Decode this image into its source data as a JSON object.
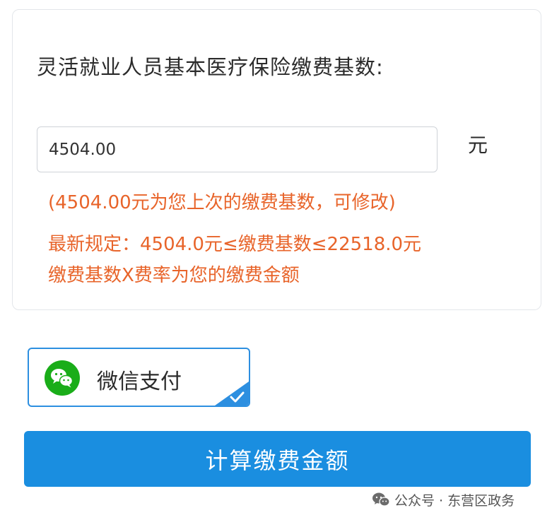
{
  "form": {
    "label": "灵活就业人员基本医疗保险缴费基数:",
    "base_value": "4504.00",
    "unit": "元",
    "note_previous": "(4504.00元为您上次的缴费基数，可修改)",
    "note_rule": "最新规定：4504.0元≤缴费基数≤22518.0元",
    "note_formula": "缴费基数X费率为您的缴费金额"
  },
  "payment": {
    "method_label": "微信支付",
    "selected": true,
    "icon": "wechat-icon",
    "check_icon": "checkmark-icon"
  },
  "actions": {
    "calculate_label": "计算缴费金额"
  },
  "watermark": {
    "text": "公众号 · 东营区政务",
    "icon": "wechat-icon"
  },
  "colors": {
    "accent_blue": "#1a8ee0",
    "selection_border": "#2d8fe0",
    "note_orange": "#e8642a",
    "wechat_green": "#1aad19",
    "text_dark": "#2b2b2b"
  }
}
